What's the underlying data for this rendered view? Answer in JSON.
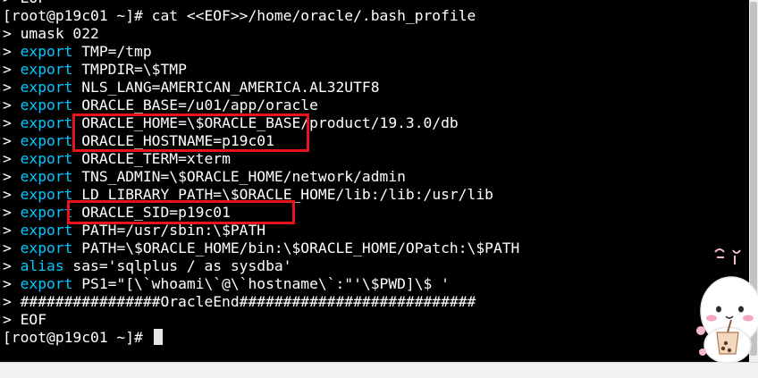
{
  "terminal": {
    "lines": [
      {
        "prefix": "> ",
        "keyword": "",
        "text": "EOF"
      },
      {
        "prefix": "[root@p19c01 ~]# ",
        "keyword": "",
        "text": "cat <<EOF>>/home/oracle/.bash_profile"
      },
      {
        "prefix": "> ",
        "keyword": "",
        "text": "umask 022"
      },
      {
        "prefix": "> ",
        "keyword": "export",
        "text": " TMP=/tmp"
      },
      {
        "prefix": "> ",
        "keyword": "export",
        "text": " TMPDIR=\\$TMP"
      },
      {
        "prefix": "> ",
        "keyword": "export",
        "text": " NLS_LANG=AMERICAN_AMERICA.AL32UTF8"
      },
      {
        "prefix": "> ",
        "keyword": "export",
        "text": " ORACLE_BASE=/u01/app/oracle"
      },
      {
        "prefix": "> ",
        "keyword": "export",
        "text": " ORACLE_HOME=\\$ORACLE_BASE/product/19.3.0/db"
      },
      {
        "prefix": "> ",
        "keyword": "export",
        "text": " ORACLE_HOSTNAME=p19c01"
      },
      {
        "prefix": "> ",
        "keyword": "export",
        "text": " ORACLE_TERM=xterm"
      },
      {
        "prefix": "> ",
        "keyword": "export",
        "text": " TNS_ADMIN=\\$ORACLE_HOME/network/admin"
      },
      {
        "prefix": "> ",
        "keyword": "export",
        "text": " LD_LIBRARY_PATH=\\$ORACLE_HOME/lib:/lib:/usr/lib"
      },
      {
        "prefix": "> ",
        "keyword": "export",
        "text": " ORACLE_SID=p19c01"
      },
      {
        "prefix": "> ",
        "keyword": "export",
        "text": " PATH=/usr/sbin:\\$PATH"
      },
      {
        "prefix": "> ",
        "keyword": "export",
        "text": " PATH=\\$ORACLE_HOME/bin:\\$ORACLE_HOME/OPatch:\\$PATH"
      },
      {
        "prefix": "> ",
        "keyword": "alias",
        "text": " sas='sqlplus / as sysdba'"
      },
      {
        "prefix": "> ",
        "keyword": "export",
        "text": " PS1=\"[\\`whoami\\`@\\`hostname\\`:\"'\\$PWD]\\$ '"
      },
      {
        "prefix": "> ",
        "keyword": "",
        "text": "################OracleEnd###########################"
      },
      {
        "prefix": "> ",
        "keyword": "",
        "text": "EOF"
      },
      {
        "prefix": "[root@p19c01 ~]# ",
        "keyword": "",
        "text": ""
      }
    ]
  },
  "colors": {
    "background": "#000000",
    "text": "#ffffff",
    "keyword": "#00c8ff",
    "annotation_box": "#e8141c"
  },
  "overlay": {
    "sticker_icon": "cartoon-mascot-sticker-icon"
  }
}
